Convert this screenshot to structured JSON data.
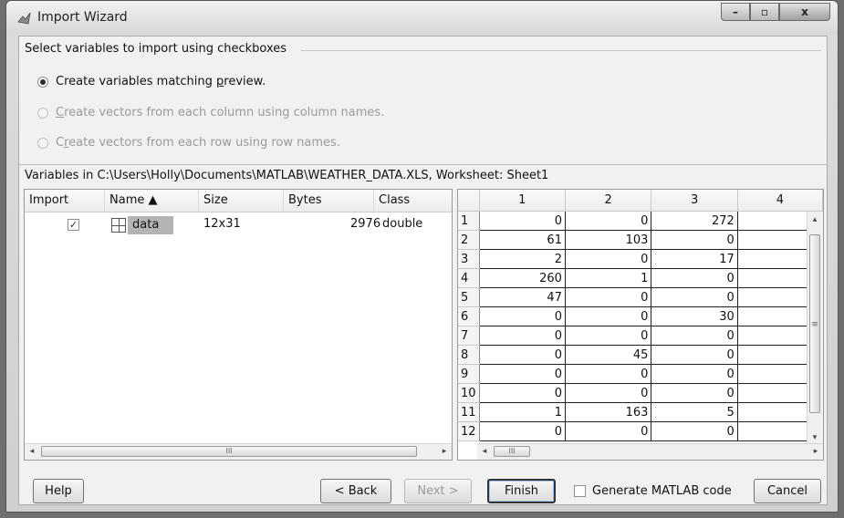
{
  "window": {
    "title": "Import Wizard",
    "minimize": "–",
    "maximize": "▫",
    "close": "x"
  },
  "options": {
    "heading": "Select variables to import using checkboxes",
    "radio1": {
      "pre": "Create variables matching ",
      "u": "p",
      "post": "review.",
      "selected": true
    },
    "radio2": {
      "pre": "",
      "u": "C",
      "post": "reate vectors from each column using column names.",
      "selected": false
    },
    "radio3": {
      "pre": "C",
      "u": "r",
      "post": "eate vectors from each row using row names.",
      "selected": false
    }
  },
  "variables_label": "Variables in C:\\Users\\Holly\\Documents\\MATLAB\\WEATHER_DATA.XLS, Worksheet: Sheet1",
  "var_table": {
    "headers": {
      "import": "Import",
      "name": "Name ▲",
      "size": "Size",
      "bytes": "Bytes",
      "class": "Class"
    },
    "row": {
      "checked": "✓",
      "name": "data",
      "size": "12x31",
      "bytes": "2976",
      "class": "double"
    }
  },
  "preview": {
    "col_headers": [
      "1",
      "2",
      "3",
      "4"
    ],
    "rows": [
      [
        "1",
        "0",
        "0",
        "272"
      ],
      [
        "2",
        "61",
        "103",
        "0"
      ],
      [
        "3",
        "2",
        "0",
        "17"
      ],
      [
        "4",
        "260",
        "1",
        "0"
      ],
      [
        "5",
        "47",
        "0",
        "0"
      ],
      [
        "6",
        "0",
        "0",
        "30"
      ],
      [
        "7",
        "0",
        "0",
        "0"
      ],
      [
        "8",
        "0",
        "45",
        "0"
      ],
      [
        "9",
        "0",
        "0",
        "0"
      ],
      [
        "10",
        "0",
        "0",
        "0"
      ],
      [
        "11",
        "1",
        "163",
        "5"
      ],
      [
        "12",
        "0",
        "0",
        "0"
      ]
    ]
  },
  "scroll": {
    "left_arrow": "◂",
    "right_arrow": "▸",
    "up_arrow": "▴",
    "down_arrow": "▾",
    "grip_h": "III",
    "grip_v": "≡"
  },
  "buttons": {
    "help": "Help",
    "back": "< Back",
    "next": "Next >",
    "finish": "Finish",
    "generate": "Generate MATLAB code",
    "cancel": "Cancel"
  }
}
